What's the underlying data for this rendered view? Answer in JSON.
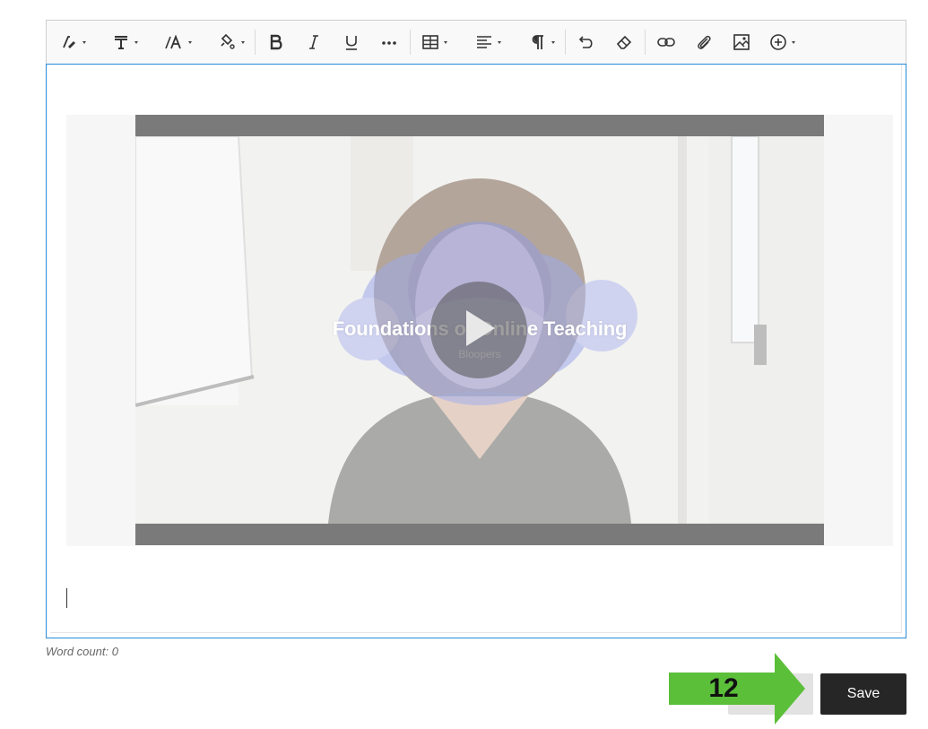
{
  "toolbar": {
    "buttons": [
      {
        "name": "format-painter-button",
        "icon": "pen-style-icon",
        "has_menu": true
      },
      {
        "name": "text-style-button",
        "icon": "text-style-icon",
        "has_menu": true
      },
      {
        "name": "font-size-button",
        "icon": "font-size-icon",
        "has_menu": true
      },
      {
        "name": "highlight-color-button",
        "icon": "paint-bucket-icon",
        "has_menu": true
      },
      {
        "name": "bold-button",
        "icon": "bold-icon"
      },
      {
        "name": "italic-button",
        "icon": "italic-icon"
      },
      {
        "name": "underline-button",
        "icon": "underline-icon"
      },
      {
        "name": "more-formatting-button",
        "icon": "more-horizontal-icon"
      },
      {
        "name": "table-button",
        "icon": "table-icon",
        "has_menu": true
      },
      {
        "name": "align-button",
        "icon": "align-left-icon",
        "has_menu": true
      },
      {
        "name": "paragraph-button",
        "icon": "pilcrow-icon",
        "has_menu": true
      },
      {
        "name": "undo-button",
        "icon": "undo-icon"
      },
      {
        "name": "clear-formatting-button",
        "icon": "eraser-icon"
      },
      {
        "name": "insert-link-button",
        "icon": "link-icon"
      },
      {
        "name": "attach-file-button",
        "icon": "paperclip-icon"
      },
      {
        "name": "insert-image-button",
        "icon": "image-icon"
      },
      {
        "name": "insert-content-button",
        "icon": "plus-circle-icon",
        "has_menu": true
      }
    ]
  },
  "video": {
    "title": "Foundations of Online Teaching",
    "subtitle": "Bloopers",
    "play_icon": "play-icon"
  },
  "footer": {
    "word_count": "Word count: 0",
    "save_label": "Save"
  },
  "callout": {
    "step": "12",
    "color": "#5bbf3a"
  },
  "colors": {
    "editor_border": "#2b8bd6",
    "save_bg": "#262626"
  }
}
